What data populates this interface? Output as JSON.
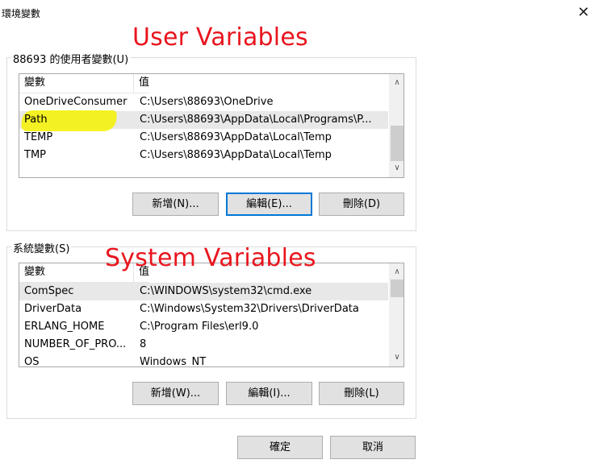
{
  "window": {
    "title": "環境變數",
    "close_glyph": "✕"
  },
  "annotations": {
    "user": "User Variables",
    "system": "System Variables"
  },
  "user_group": {
    "label": "88693 的使用者變數(U)",
    "columns": [
      "變數",
      "值"
    ],
    "rows": [
      {
        "name": "OneDriveConsumer",
        "value": "C:\\Users\\88693\\OneDrive"
      },
      {
        "name": "Path",
        "value": "C:\\Users\\88693\\AppData\\Local\\Programs\\P..."
      },
      {
        "name": "TEMP",
        "value": "C:\\Users\\88693\\AppData\\Local\\Temp"
      },
      {
        "name": "TMP",
        "value": "C:\\Users\\88693\\AppData\\Local\\Temp"
      }
    ],
    "buttons": {
      "new": "新增(N)...",
      "edit": "編輯(E)...",
      "delete": "刪除(D)"
    }
  },
  "system_group": {
    "label": "系統變數(S)",
    "columns": [
      "變數",
      "值"
    ],
    "rows": [
      {
        "name": "ComSpec",
        "value": "C:\\WINDOWS\\system32\\cmd.exe"
      },
      {
        "name": "DriverData",
        "value": "C:\\Windows\\System32\\Drivers\\DriverData"
      },
      {
        "name": "ERLANG_HOME",
        "value": "C:\\Program Files\\erl9.0"
      },
      {
        "name": "NUMBER_OF_PRO...",
        "value": "8"
      },
      {
        "name": "OS",
        "value": "Windows_NT"
      }
    ],
    "buttons": {
      "new": "新增(W)...",
      "edit": "編輯(I)...",
      "delete": "刪除(L)"
    }
  },
  "footer": {
    "ok": "確定",
    "cancel": "取消"
  },
  "scroll_glyphs": {
    "up": "∧",
    "down": "∨"
  }
}
